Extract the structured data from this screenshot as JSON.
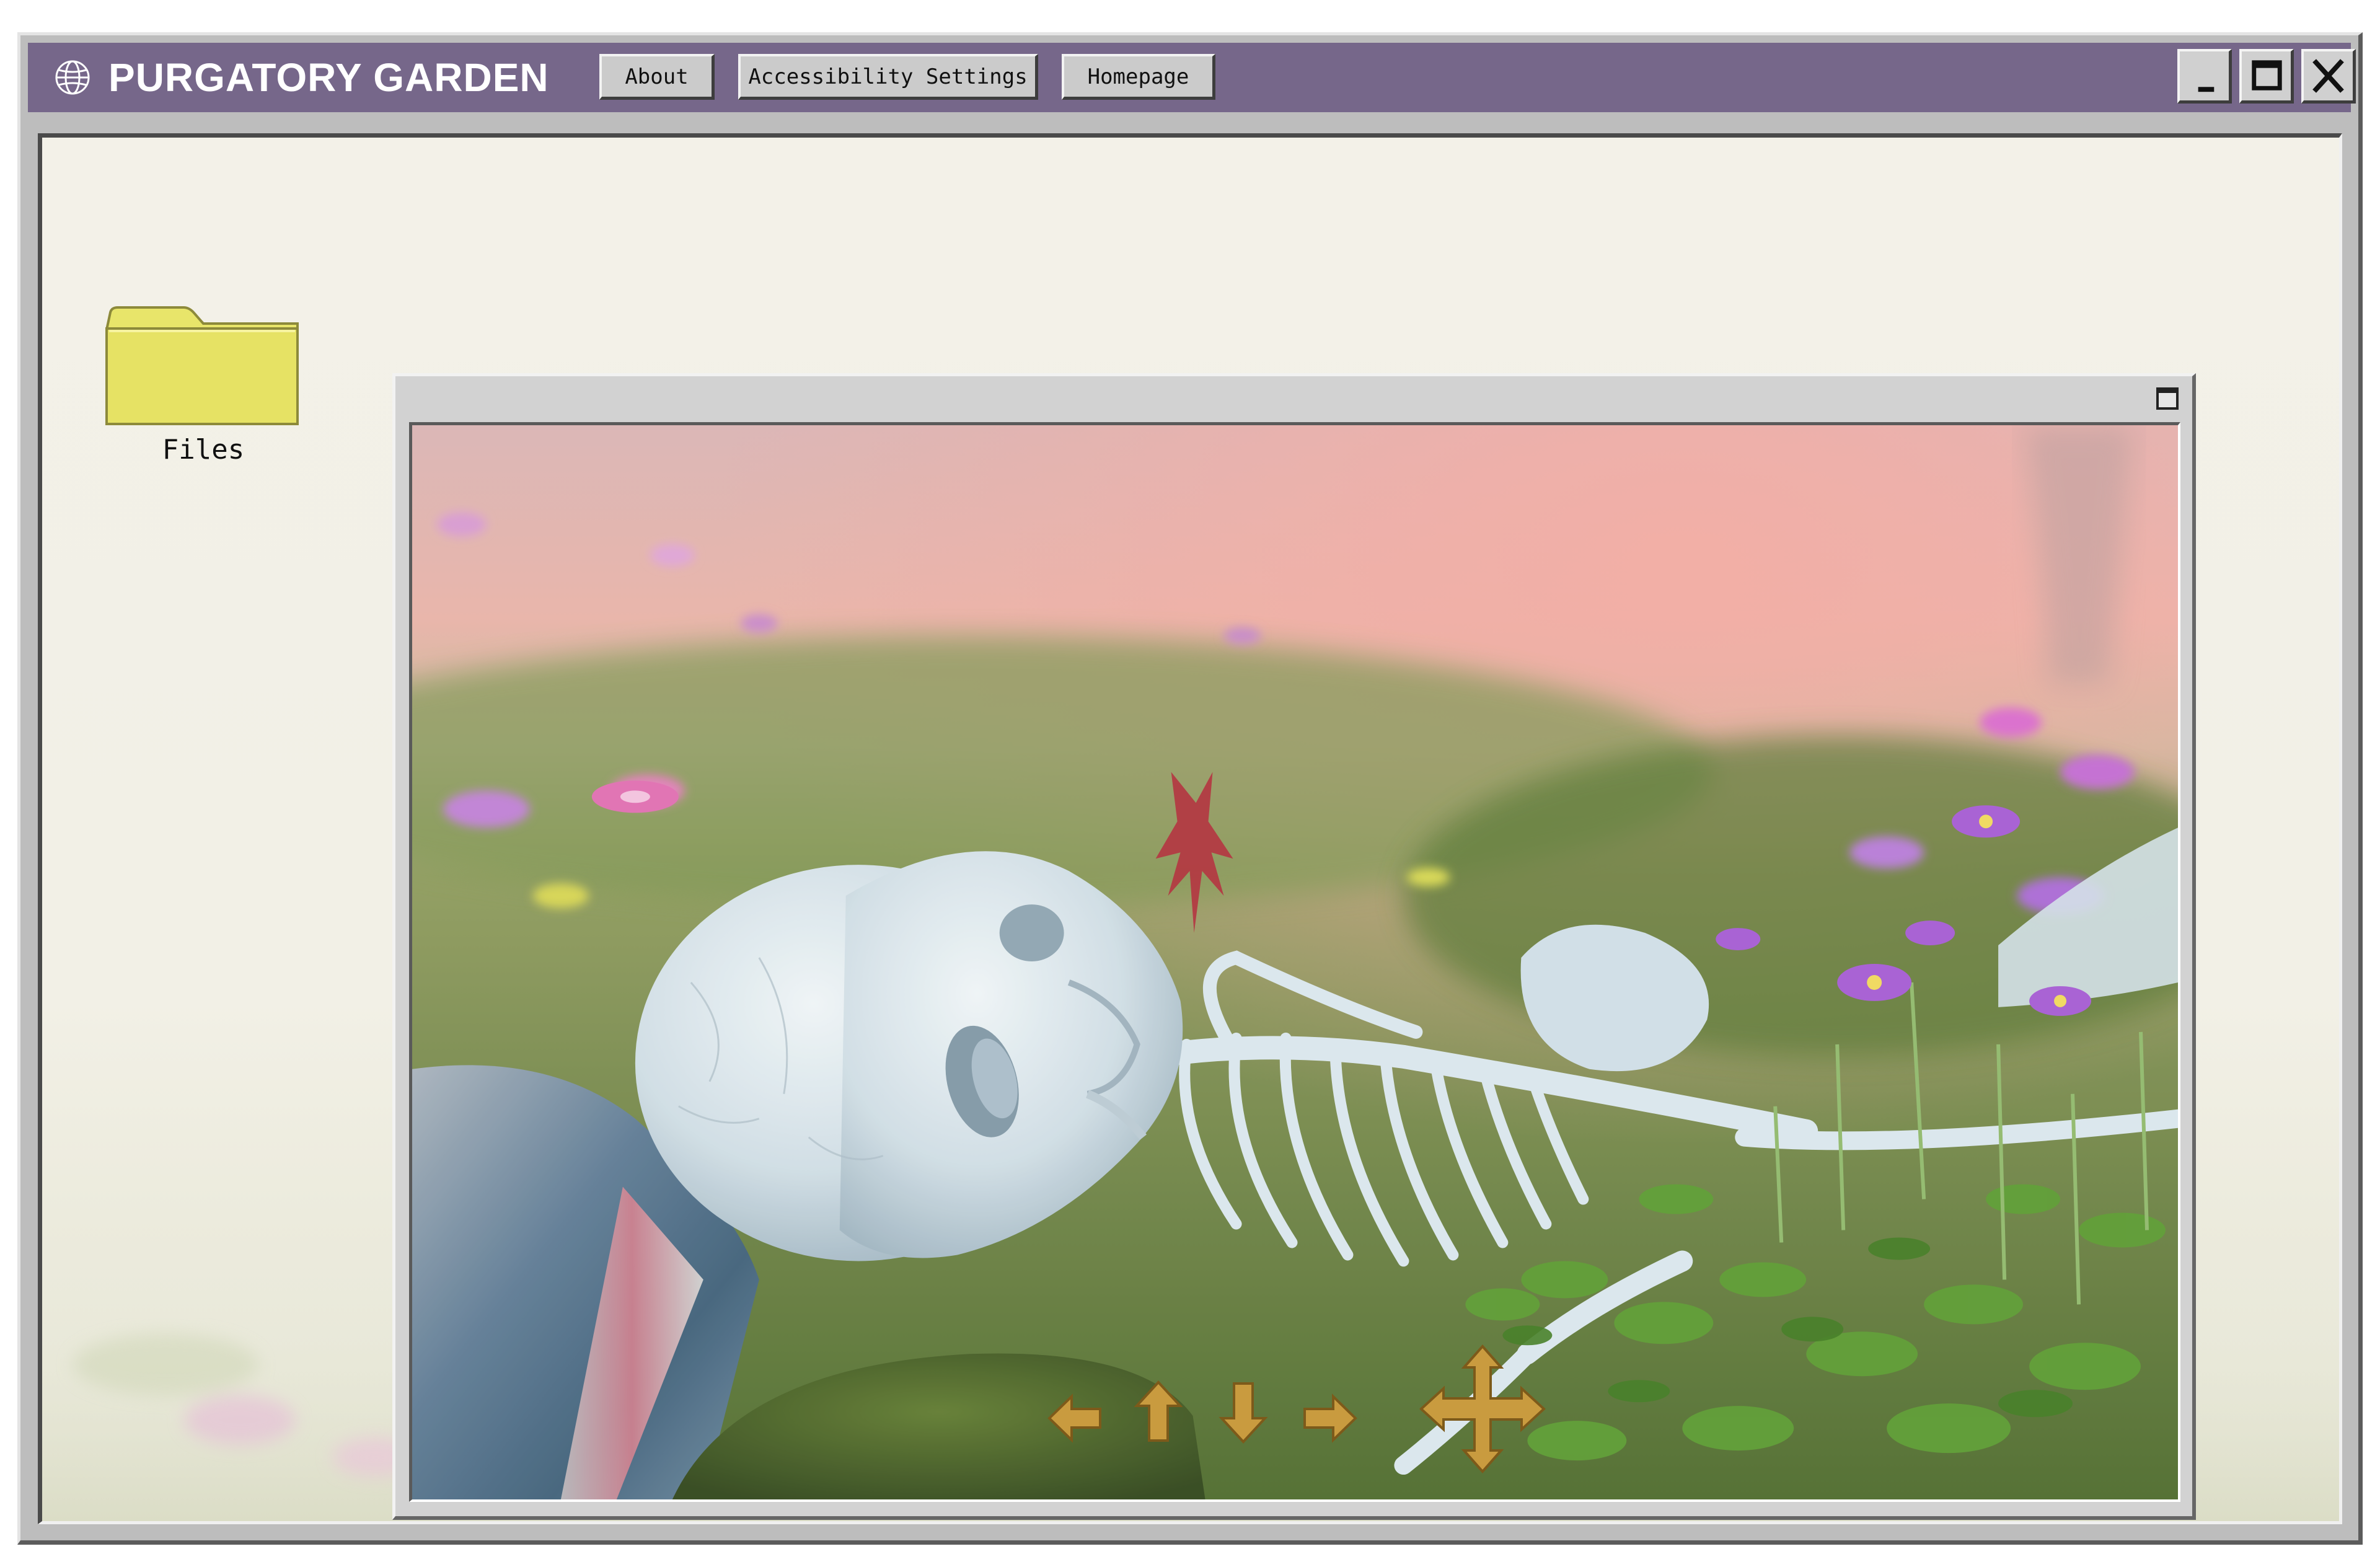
{
  "app": {
    "title": "PURGATORY GARDEN",
    "icon": "globe-icon"
  },
  "toolbar": {
    "about_label": "About",
    "accessibility_label": "Accessibility Settings",
    "homepage_label": "Homepage"
  },
  "window_controls": {
    "minimize_icon": "minimize-icon",
    "maximize_icon": "maximize-icon",
    "close_icon": "close-icon"
  },
  "desktop": {
    "items": [
      {
        "label": "Files",
        "icon": "folder-icon"
      }
    ]
  },
  "viewer": {
    "controls": [
      "viewer-maximize-icon"
    ],
    "scene": "skeleton lying in a flower meadow",
    "nav_controls": [
      "arrow-left-icon",
      "arrow-up-icon",
      "arrow-down-icon",
      "arrow-right-icon",
      "move-cross-icon"
    ]
  },
  "colors": {
    "titlebar": "#76678a",
    "chrome": "#bdbdbd",
    "desktop": "#f3f1e8",
    "folder": "#e6e264",
    "arrow": "#c89a3e"
  }
}
